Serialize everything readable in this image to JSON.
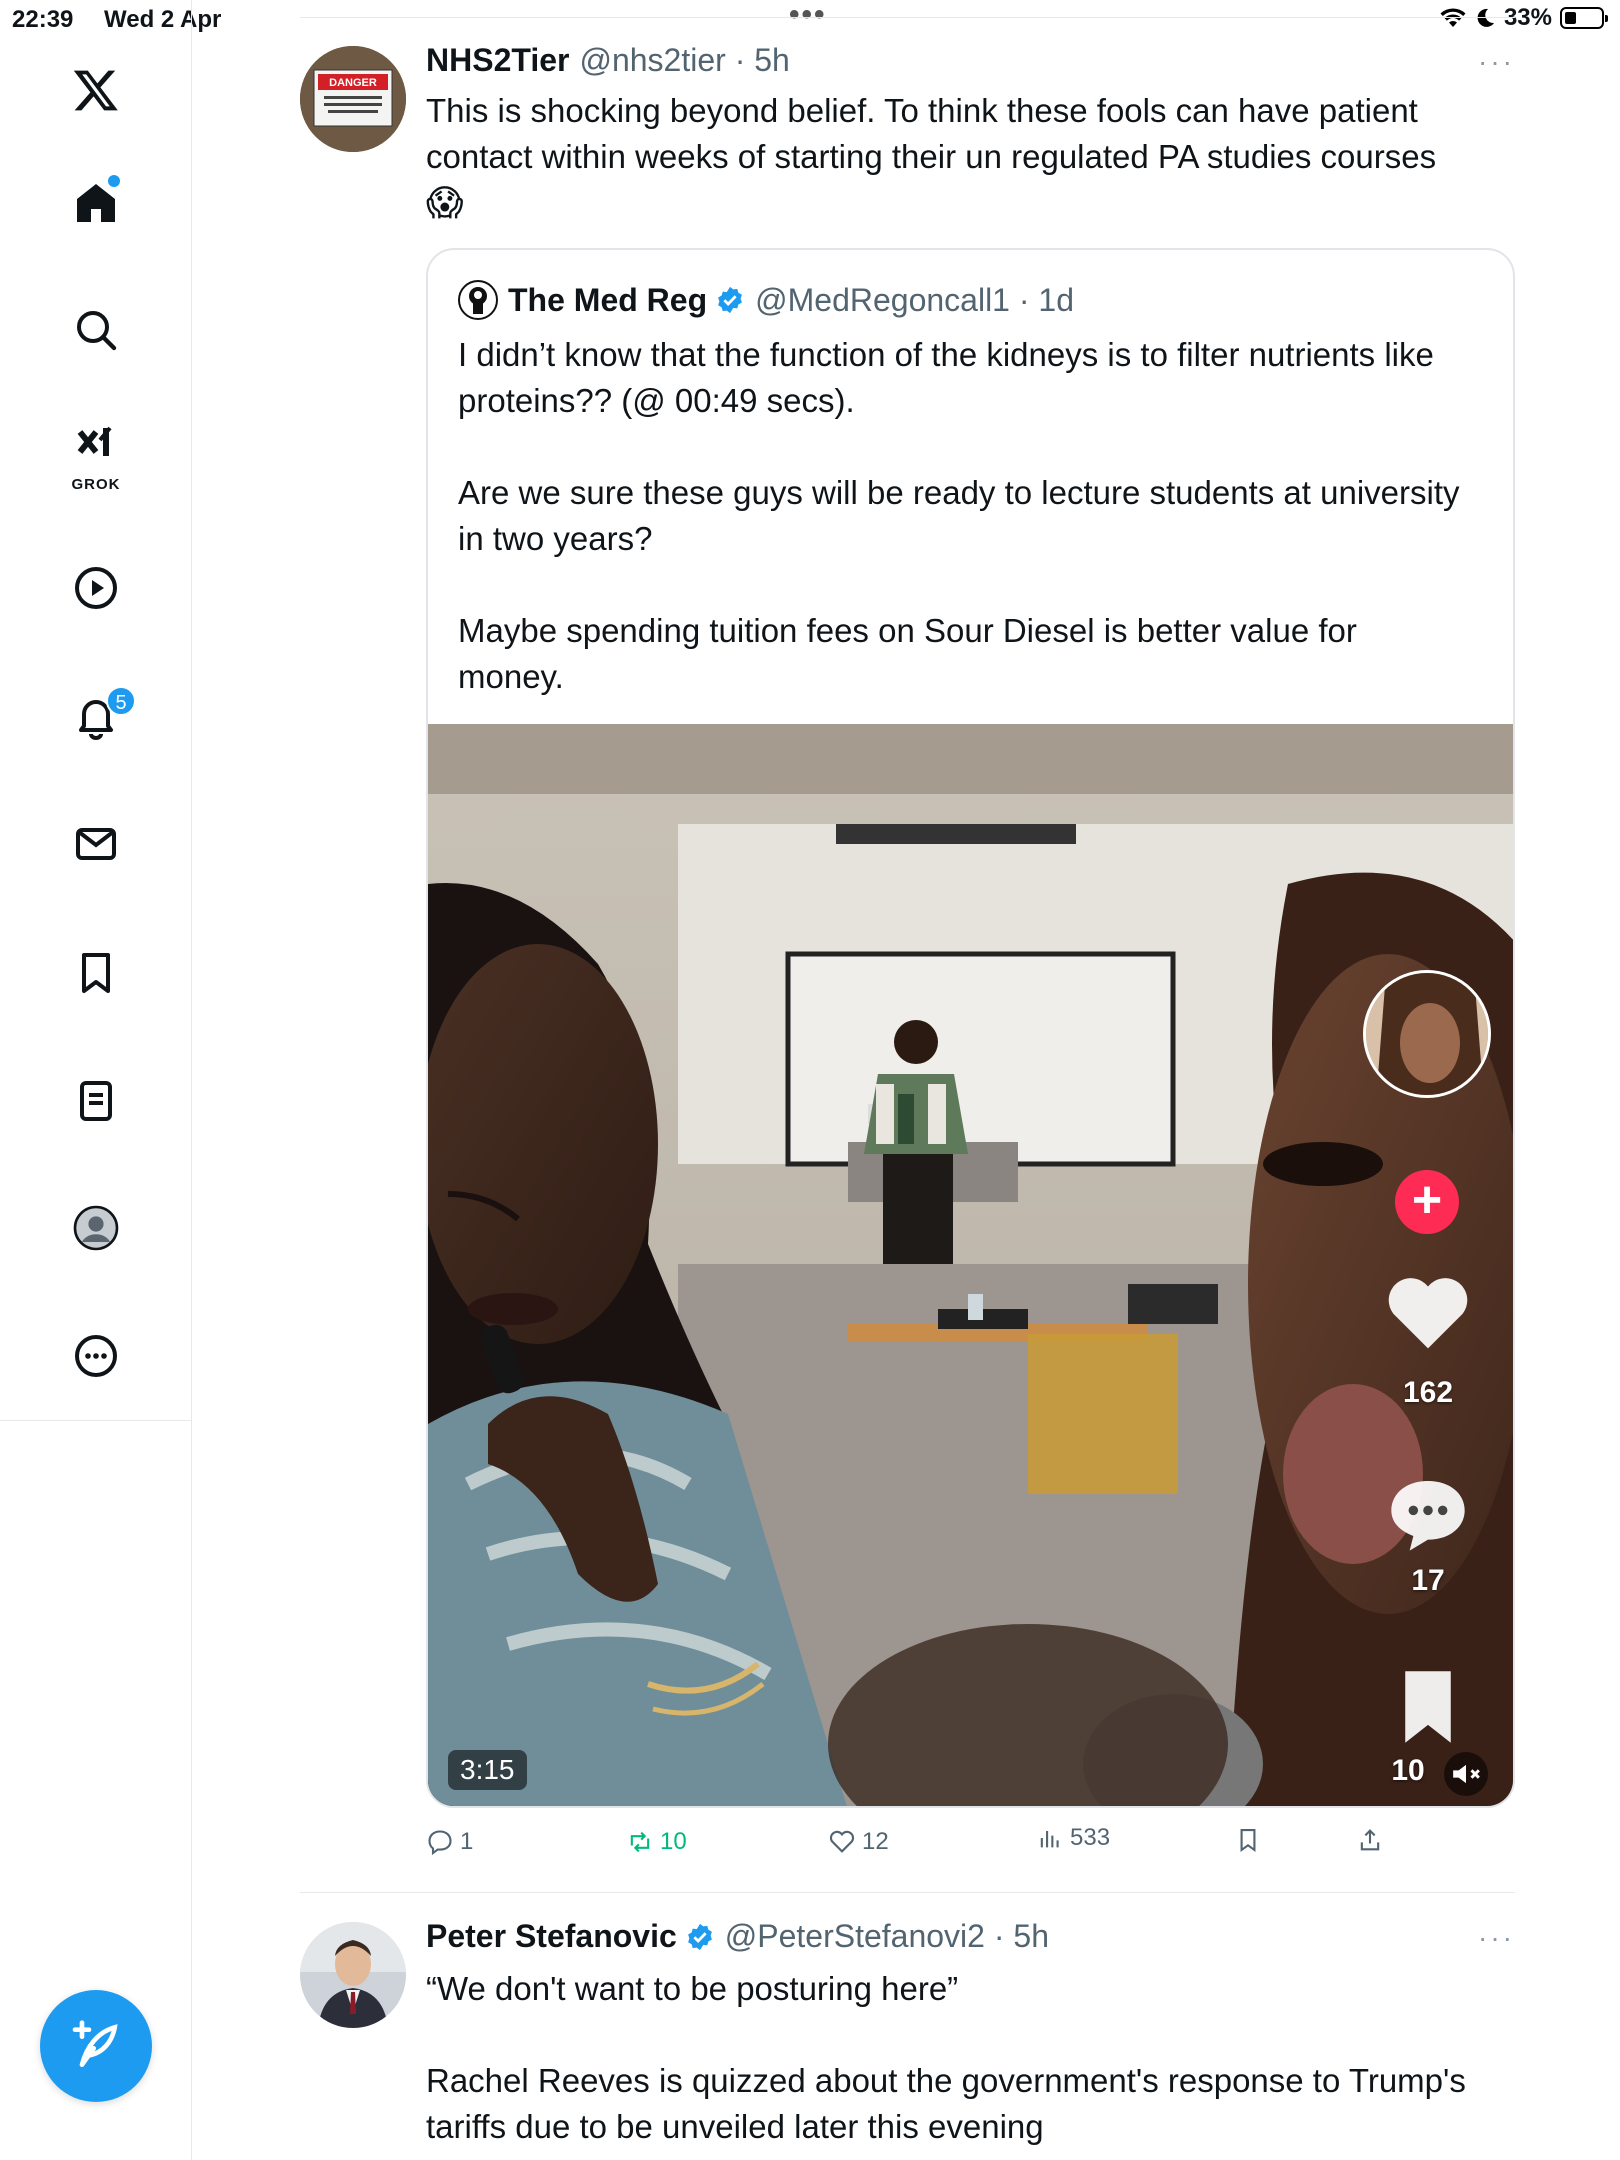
{
  "status_bar": {
    "time": "22:39",
    "date": "Wed 2 Apr",
    "battery": "33%",
    "battery_level": 0.33
  },
  "sidebar": {
    "grok_label": "GROK",
    "notifications_badge": "5",
    "icons": [
      "x-logo-icon",
      "home-icon",
      "search-icon",
      "grok-icon",
      "video-icon",
      "bell-icon",
      "mail-icon",
      "bookmark-icon",
      "lists-icon",
      "profile-icon",
      "more-icon",
      "compose-icon"
    ]
  },
  "tweet1": {
    "name": "NHS2Tier",
    "meta": "@nhs2tier · 5h",
    "text": "This is shocking beyond belief. To think these fools can have patient contact within weeks of starting their un regulated PA studies courses",
    "emoji": "😱",
    "avatar_sign_text": "DANGER",
    "avatar_sign_sub": "AUTHORIZED PERSONNEL ONLY BEYOND THIS POINT",
    "quote": {
      "name": "The Med Reg",
      "meta": "@MedRegoncall1 · 1d",
      "paragraphs": [
        "I didn’t know that the function of the kidneys is to filter nutrients like proteins?? (@ 00:49 secs).",
        "Are we sure these guys will be ready to lecture students at university in two years?",
        "Maybe spending tuition fees on Sour Diesel is better value for money."
      ],
      "video": {
        "duration": "3:15",
        "likes": "162",
        "comments": "17",
        "saves": "10"
      }
    },
    "actions": {
      "replies": "1",
      "reposts": "10",
      "likes": "12",
      "views": "533"
    }
  },
  "tweet2": {
    "name": "Peter Stefanovic",
    "meta": "@PeterStefanovi2 · 5h",
    "text_line1": "“We don't want to be posturing here”",
    "text_line2": "Rachel Reeves is quizzed about the government's response to Trump's tariffs due to be unveiled later this evening"
  },
  "colors": {
    "accent": "#1d9bf0",
    "repost_green": "#00ba7c",
    "muted": "#536471"
  }
}
